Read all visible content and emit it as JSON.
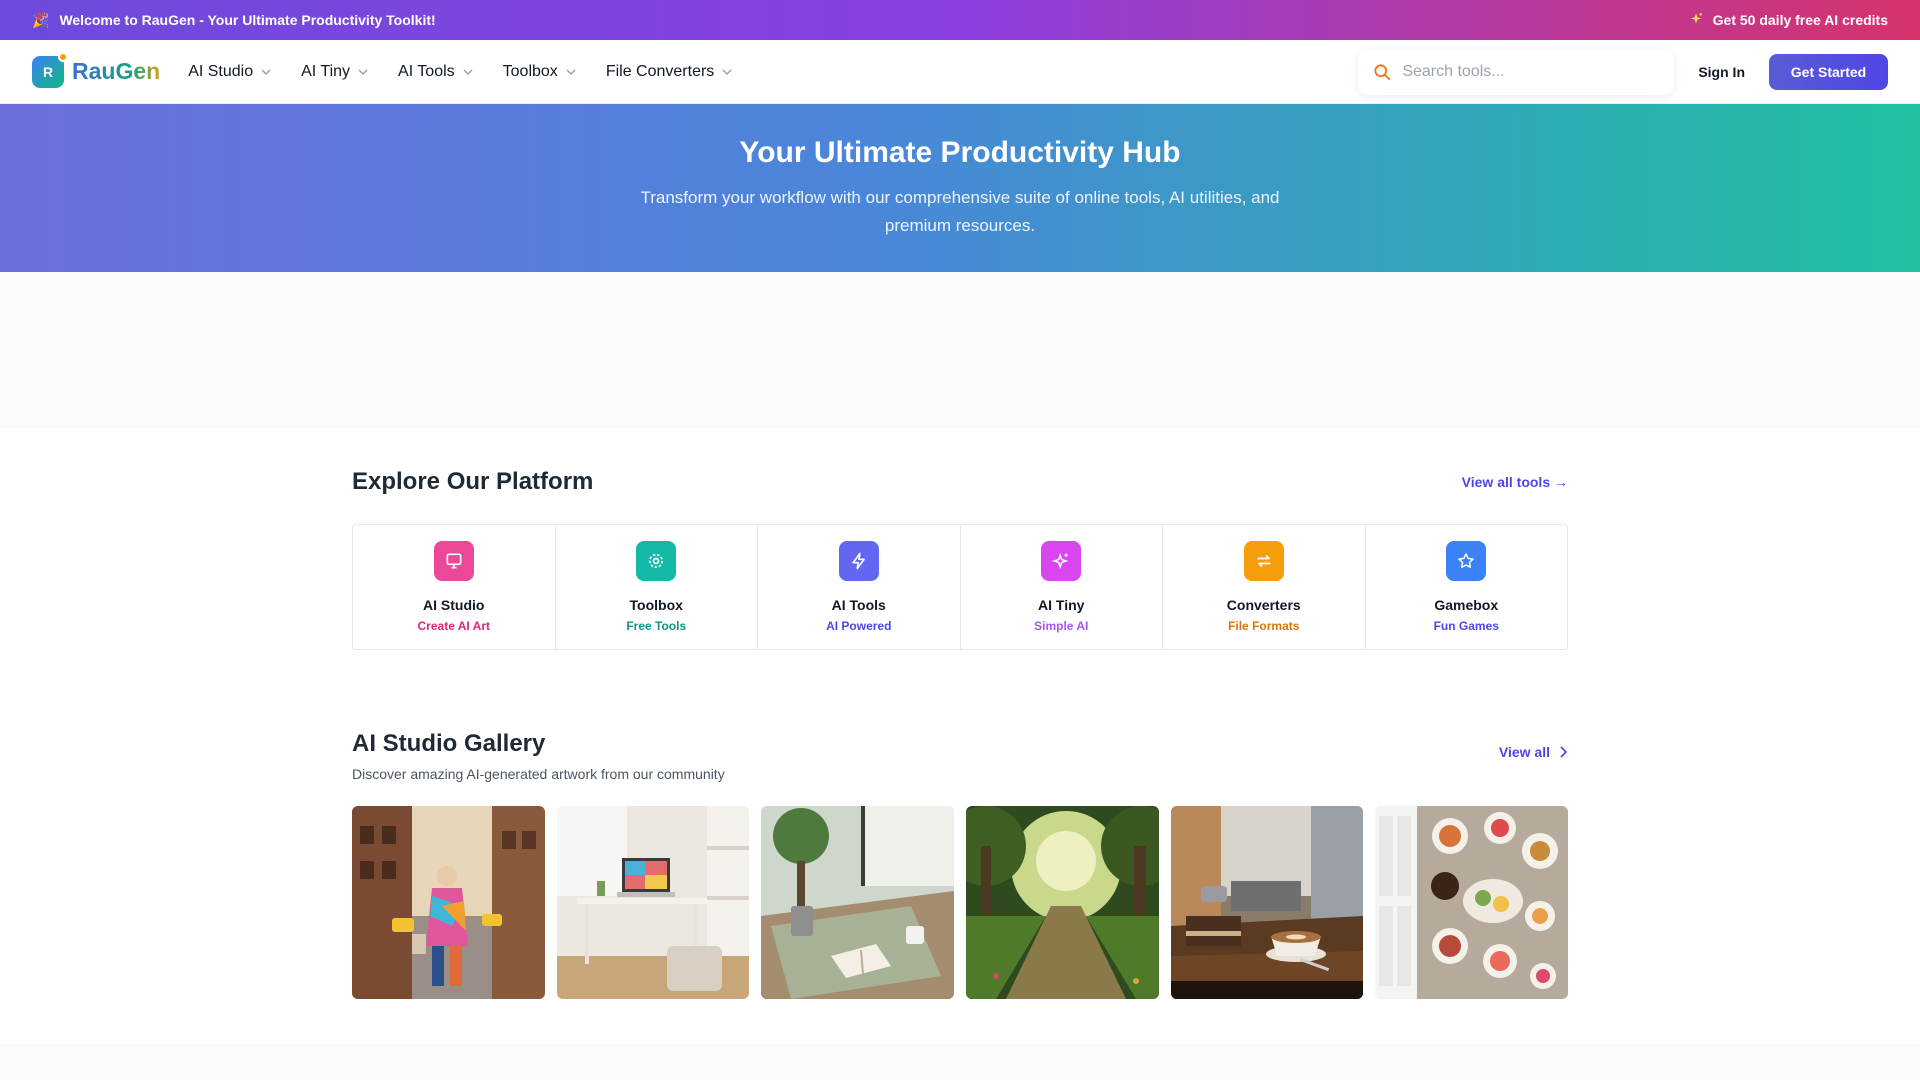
{
  "announcement": {
    "left_emoji": "🎉",
    "text": "Welcome to RauGen - Your Ultimate Productivity Toolkit!",
    "right_text": "Get 50 daily free AI credits"
  },
  "nav": {
    "logo_letter": "R",
    "logo_text": "RauGen",
    "menu": [
      {
        "label": "AI Studio"
      },
      {
        "label": "AI Tiny"
      },
      {
        "label": "AI Tools"
      },
      {
        "label": "Toolbox"
      },
      {
        "label": "File Converters"
      }
    ],
    "search_placeholder": "Search tools...",
    "signin": "Sign In",
    "cta": "Get Started"
  },
  "hero": {
    "title": "Your Ultimate Productivity Hub",
    "subtitle": "Transform your workflow with our comprehensive suite of online tools, AI utilities, and premium resources."
  },
  "explore": {
    "title": "Explore Our Platform",
    "view_all": "View all tools →",
    "cards": [
      {
        "title": "AI Studio",
        "subtitle": "Create AI Art",
        "icon": "monitor-icon",
        "color": "#ec4899",
        "sub_color": "#db2777"
      },
      {
        "title": "Toolbox",
        "subtitle": "Free Tools",
        "icon": "gear-icon",
        "color": "#14b8a6",
        "sub_color": "#0f9488"
      },
      {
        "title": "AI Tools",
        "subtitle": "AI Powered",
        "icon": "bolt-icon",
        "color": "#6366f1",
        "sub_color": "#4f46e5"
      },
      {
        "title": "AI Tiny",
        "subtitle": "Simple AI",
        "icon": "sparkle-icon",
        "color": "#d946ef",
        "sub_color": "#a855f7"
      },
      {
        "title": "Converters",
        "subtitle": "File Formats",
        "icon": "swap-icon",
        "color": "#f59e0b",
        "sub_color": "#d97706"
      },
      {
        "title": "Gamebox",
        "subtitle": "Fun Games",
        "icon": "star-icon",
        "color": "#3b82f6",
        "sub_color": "#4f46e5"
      }
    ]
  },
  "gallery": {
    "title": "AI Studio Gallery",
    "subtitle": "Discover amazing AI-generated artwork from our community",
    "view_all": "View all",
    "items": [
      {
        "name": "gallery-image-city-street"
      },
      {
        "name": "gallery-image-desk-workspace"
      },
      {
        "name": "gallery-image-book-on-floor"
      },
      {
        "name": "gallery-image-forest-path"
      },
      {
        "name": "gallery-image-coffee-cafe"
      },
      {
        "name": "gallery-image-food-table"
      }
    ]
  }
}
